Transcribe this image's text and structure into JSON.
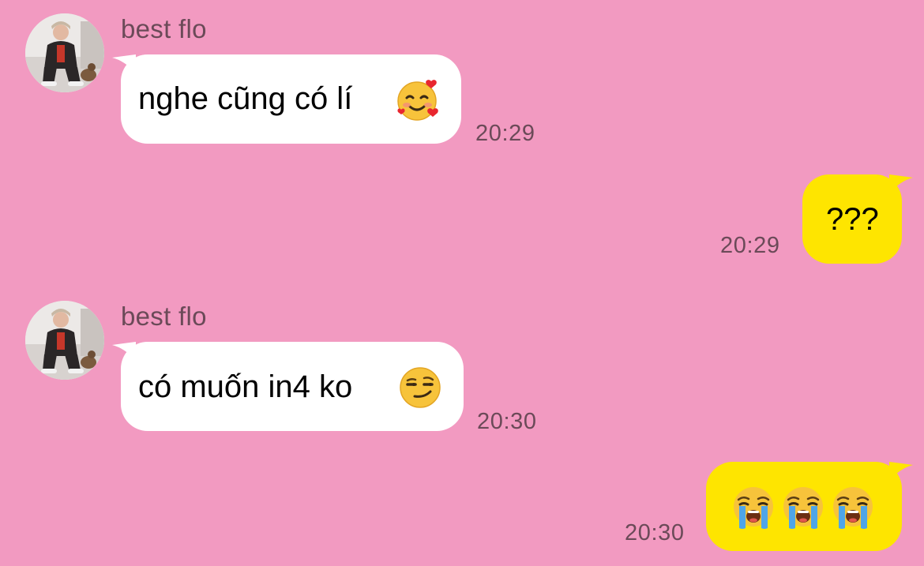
{
  "colors": {
    "background": "#f29ac1",
    "incoming_bubble": "#ffffff",
    "outgoing_bubble": "#fee500",
    "meta_text": "#6b4a58"
  },
  "messages": [
    {
      "direction": "incoming",
      "sender": "best flo",
      "text": "nghe cũng có lí",
      "emoji": "smiling-face-with-hearts-icon",
      "time": "20:29"
    },
    {
      "direction": "outgoing",
      "text": "???",
      "time": "20:29"
    },
    {
      "direction": "incoming",
      "sender": "best flo",
      "text": "có muốn in4 ko",
      "emoji": "smirking-face-icon",
      "time": "20:30"
    },
    {
      "direction": "outgoing",
      "text": "",
      "emoji": "loudly-crying-face-icon x3",
      "time": "20:30"
    }
  ]
}
